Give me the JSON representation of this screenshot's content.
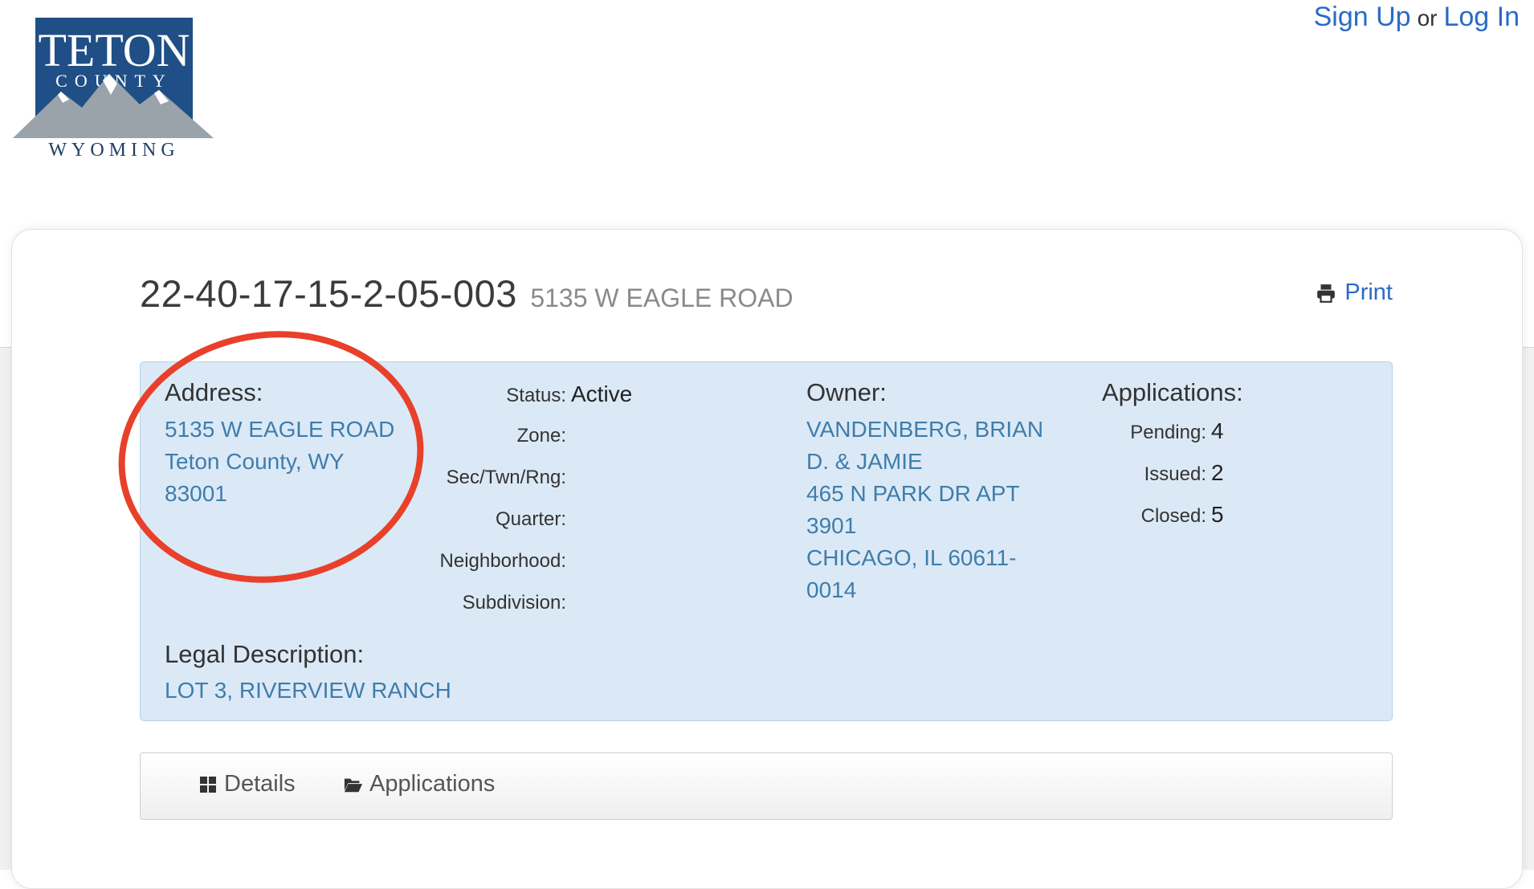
{
  "logo": {
    "line1": "TETON",
    "line2": "COUNTY",
    "line3": "WYOMING"
  },
  "auth": {
    "signup": "Sign Up",
    "or": "or",
    "login": "Log In"
  },
  "header": {
    "parcel_id": "22-40-17-15-2-05-003",
    "address": "5135 W EAGLE ROAD",
    "print_label": "Print"
  },
  "address": {
    "label": "Address:",
    "lines": [
      "5135 W EAGLE ROAD",
      "Teton County,  WY",
      "83001"
    ]
  },
  "details": {
    "status_label": "Status:",
    "status_value": "Active",
    "zone_label": "Zone:",
    "sec_label": "Sec/Twn/Rng:",
    "quarter_label": "Quarter:",
    "neighborhood_label": "Neighborhood:",
    "subdivision_label": "Subdivision:"
  },
  "owner": {
    "label": "Owner:",
    "lines": [
      "VANDENBERG, BRIAN",
      "D. & JAMIE",
      "465 N PARK DR APT",
      "3901",
      "CHICAGO,  IL  60611-",
      "0014"
    ]
  },
  "applications": {
    "label": "Applications:",
    "pending_label": "Pending:",
    "pending": "4",
    "issued_label": "Issued:",
    "issued": "2",
    "closed_label": "Closed:",
    "closed": "5"
  },
  "legal": {
    "label": "Legal Description:",
    "value": "LOT 3, RIVERVIEW RANCH"
  },
  "tabs": {
    "details": "Details",
    "applications": "Applications"
  },
  "colors": {
    "link": "#2a6ac8",
    "panel": "#dbe9f6",
    "circle": "#e8402a",
    "logo_blue": "#1f4f86"
  }
}
